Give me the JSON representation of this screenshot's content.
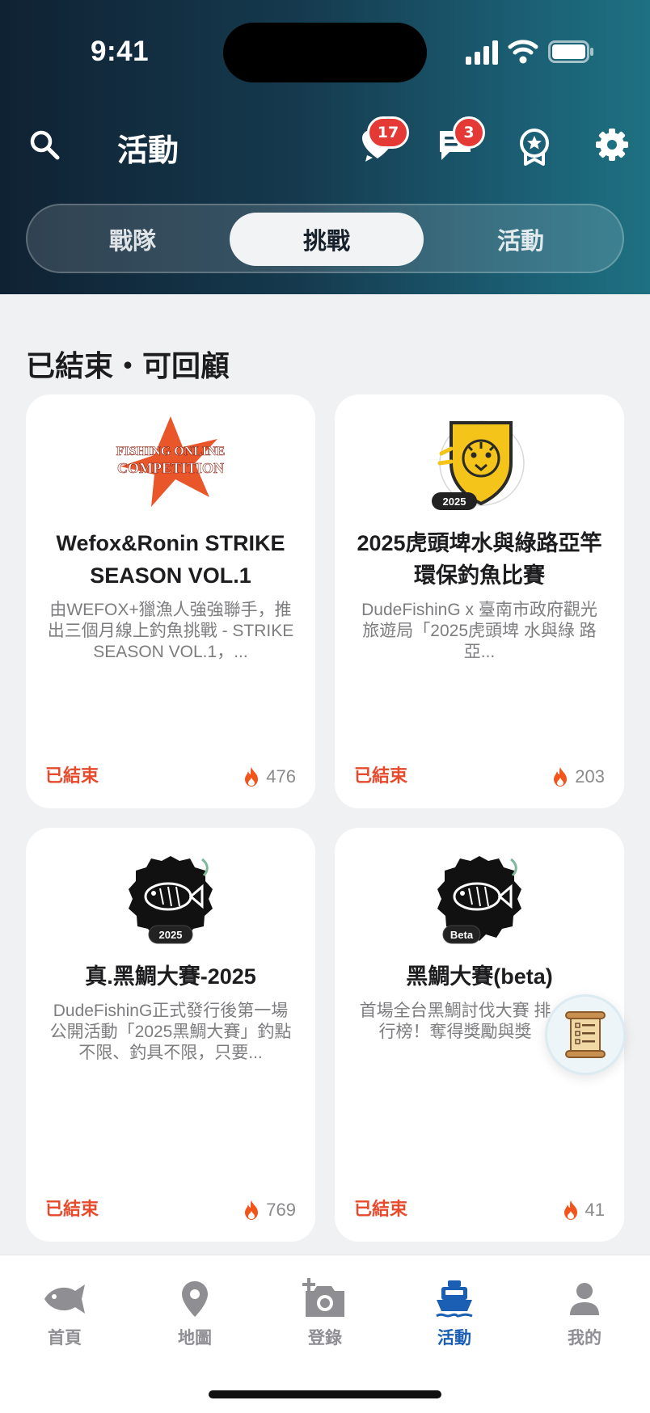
{
  "status_bar": {
    "time": "9:41"
  },
  "header": {
    "title": "活動",
    "badges": {
      "favorites_count": "17",
      "messages_count": "3"
    }
  },
  "segments": [
    {
      "label": "戰隊",
      "active": false
    },
    {
      "label": "挑戰",
      "active": true
    },
    {
      "label": "活動",
      "active": false
    }
  ],
  "section": {
    "title": "已結束・可回顧"
  },
  "cards": [
    {
      "logo_text": "FISHING ONLINE COMPETITION",
      "title": "Wefox&Ronin STRIKE SEASON VOL.1",
      "description": "由WEFOX+獵漁人強強聯手，推出三個月線上釣魚挑戰 - STRIKE SEASON VOL.1，...",
      "status": "已結束",
      "count": "476"
    },
    {
      "logo_text": "2025",
      "title": "2025虎頭埤水與綠路亞竿環保釣魚比賽",
      "description": "DudeFishinG x 臺南市政府觀光旅遊局「2025虎頭埤 水與綠 路亞...",
      "status": "已結束",
      "count": "203"
    },
    {
      "logo_text": "2025",
      "title": "真.黑鯛大賽-2025",
      "description": "DudeFishinG正式發行後第一場公開活動「2025黑鯛大賽」釣點不限、釣具不限，只要...",
      "status": "已結束",
      "count": "769"
    },
    {
      "logo_text": "Beta",
      "title": "黑鯛大賽(beta)",
      "description": "首場全台黑鯛討伐大賽 排行榜！奪得獎勵與獎",
      "status": "已結束",
      "count": "41"
    }
  ],
  "bottom_nav": [
    {
      "label": "首頁",
      "icon": "fish-icon",
      "active": false
    },
    {
      "label": "地圖",
      "icon": "map-pin-icon",
      "active": false
    },
    {
      "label": "登錄",
      "icon": "camera-add-icon",
      "active": false
    },
    {
      "label": "活動",
      "icon": "ship-icon",
      "active": true
    },
    {
      "label": "我的",
      "icon": "person-icon",
      "active": false
    }
  ],
  "colors": {
    "accent": "#1a5fb4",
    "ended_status": "#e54b2c",
    "badge": "#e53935",
    "flame": "#f2541b"
  }
}
